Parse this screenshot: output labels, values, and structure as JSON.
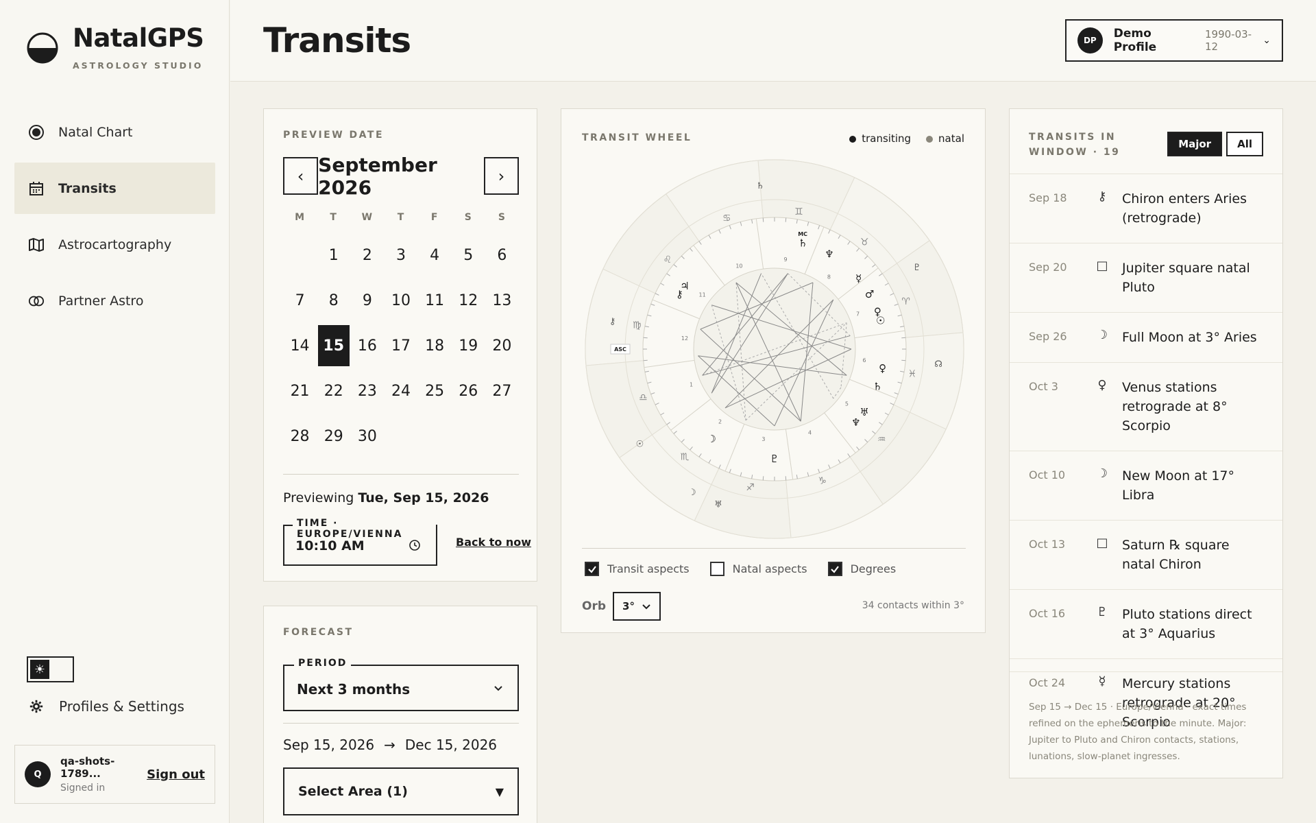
{
  "brand": {
    "name": "NatalGPS",
    "subtitle": "ASTROLOGY STUDIO"
  },
  "nav": [
    {
      "label": "Natal Chart",
      "icon": "natal-chart-icon",
      "active": false
    },
    {
      "label": "Transits",
      "icon": "calendar-icon",
      "active": true
    },
    {
      "label": "Astrocartography",
      "icon": "map-icon",
      "active": false
    },
    {
      "label": "Partner Astro",
      "icon": "rings-icon",
      "active": false
    }
  ],
  "sidebar": {
    "settings_label": "Profiles & Settings",
    "theme_icon": "☀",
    "user": {
      "initial": "Q",
      "name": "qa-shots-1789...",
      "status": "Signed in",
      "signout": "Sign out"
    }
  },
  "header": {
    "title": "Transits",
    "profile": {
      "initials": "DP",
      "name": "Demo Profile",
      "date": "1990-03-12",
      "chevron": "⌄"
    }
  },
  "preview": {
    "label": "PREVIEW DATE",
    "month": "September 2026",
    "prev": "‹",
    "next": "›",
    "dow": [
      "M",
      "T",
      "W",
      "T",
      "F",
      "S",
      "S"
    ],
    "days": [
      "",
      "1",
      "2",
      "3",
      "4",
      "5",
      "6",
      "7",
      "8",
      "9",
      "10",
      "11",
      "12",
      "13",
      "14",
      "15",
      "16",
      "17",
      "18",
      "19",
      "20",
      "21",
      "22",
      "23",
      "24",
      "25",
      "26",
      "27",
      "28",
      "29",
      "30"
    ],
    "selected": "15",
    "previewing": "Previewing",
    "previewing_date": "Tue, Sep 15, 2026",
    "time_label": "TIME · EUROPE/VIENNA",
    "time_value": "10:10 AM",
    "back_now": "Back to now"
  },
  "forecast": {
    "label": "FORECAST",
    "period_label": "PERIOD",
    "period_value": "Next 3 months",
    "range_start": "Sep 15, 2026",
    "arrow": "→",
    "range_end": "Dec 15, 2026",
    "area_value": "Select Area (1)",
    "area_caret": "▼"
  },
  "wheel": {
    "label": "TRANSIT WHEEL",
    "legend_transiting": "transiting",
    "legend_natal": "natal",
    "signs": [
      "♈",
      "♉",
      "♊",
      "♋",
      "♌",
      "♍",
      "♎",
      "♏",
      "♐",
      "♑",
      "♒",
      "♓"
    ],
    "houses": [
      "1",
      "2",
      "3",
      "4",
      "5",
      "6",
      "7",
      "8",
      "9",
      "10",
      "11",
      "12"
    ],
    "angles": {
      "asc": "ASC",
      "mc": "MC"
    },
    "transit_aspects": "Transit aspects",
    "natal_aspects": "Natal aspects",
    "degrees": "Degrees",
    "transit_on": true,
    "natal_on": false,
    "degrees_on": true,
    "orb_label": "Orb",
    "orb_value": "3°",
    "contacts": "34 contacts within 3°",
    "colors": {
      "transiting": "#1c1c1c",
      "natal": "#8a877b"
    }
  },
  "transits": {
    "title": "TRANSITS IN WINDOW · 19",
    "major": "Major",
    "all": "All",
    "items": [
      {
        "date": "Sep 18",
        "symbol": "⚷",
        "text": "Chiron enters Aries (retrograde)"
      },
      {
        "date": "Sep 20",
        "symbol": "□",
        "text": "Jupiter square natal Pluto"
      },
      {
        "date": "Sep 26",
        "symbol": "☽",
        "text": "Full Moon at 3° Aries"
      },
      {
        "date": "Oct 3",
        "symbol": "♀",
        "text": "Venus stations retrograde at 8° Scorpio"
      },
      {
        "date": "Oct 10",
        "symbol": "☽",
        "text": "New Moon at 17° Libra"
      },
      {
        "date": "Oct 13",
        "symbol": "□",
        "text": "Saturn ℞ square natal Chiron"
      },
      {
        "date": "Oct 16",
        "symbol": "♇",
        "text": "Pluto stations direct at 3° Aquarius"
      },
      {
        "date": "Oct 24",
        "symbol": "☿",
        "text": "Mercury stations retrograde at 20° Scorpio"
      }
    ],
    "footnote": "Sep 15 → Dec 15 · Europe/Vienna · exact times refined on the ephemeris to the minute. Major: Jupiter to Pluto and Chiron contacts, stations, lunations, slow-planet ingresses."
  }
}
